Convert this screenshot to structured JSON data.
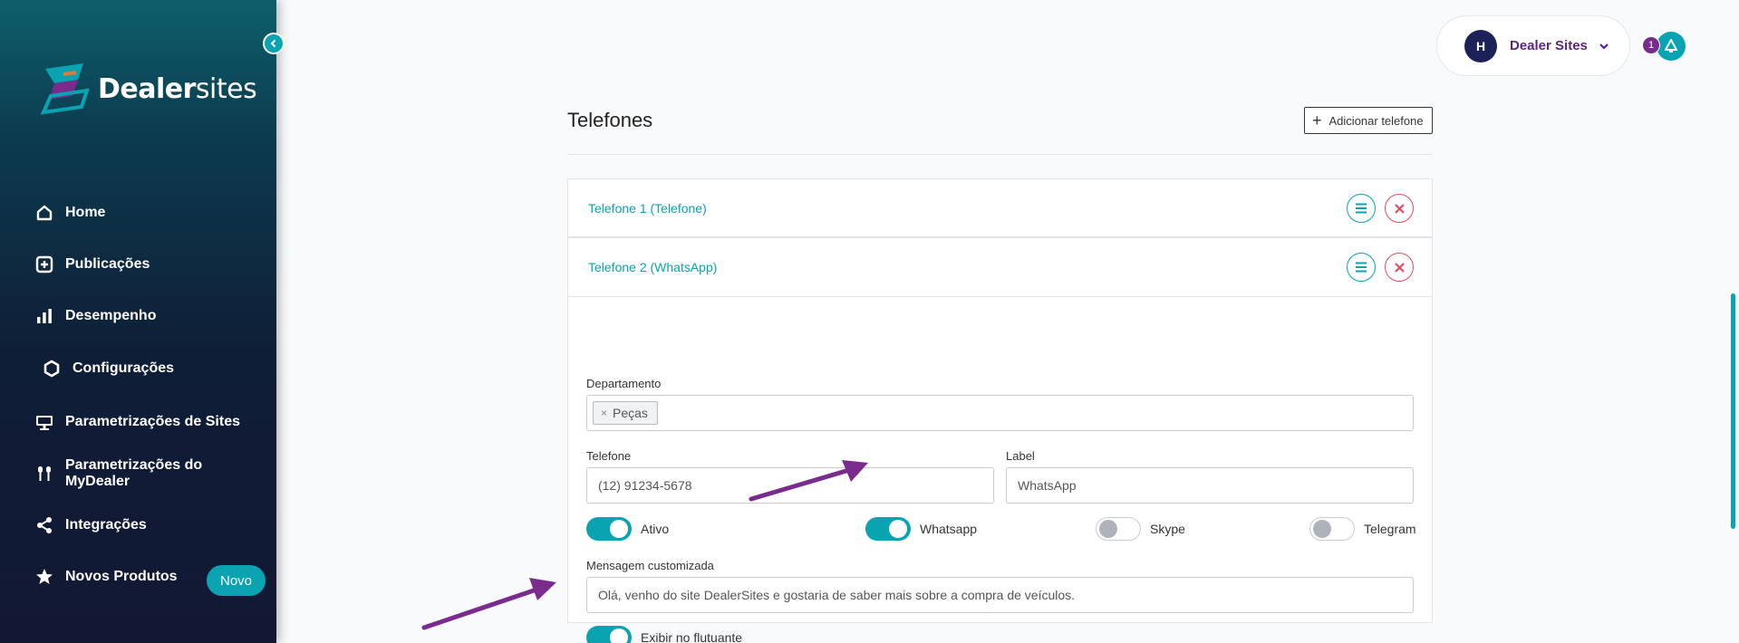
{
  "sidebar": {
    "logo_bold": "Dealer",
    "logo_light": "sites",
    "items": [
      {
        "label": "Home",
        "icon": "home-icon"
      },
      {
        "label": "Publicações",
        "icon": "plus-square-icon"
      },
      {
        "label": "Desempenho",
        "icon": "bar-chart-icon"
      },
      {
        "label": "Configurações",
        "icon": "hexagon-icon"
      },
      {
        "label": "Parametrizações de Sites",
        "icon": "monitor-icon"
      },
      {
        "label": "Parametrizações do MyDealer",
        "icon": "utensils-icon"
      },
      {
        "label": "Integrações",
        "icon": "share-icon"
      },
      {
        "label": "Novos Produtos",
        "icon": "star-icon"
      }
    ],
    "badge": "Novo"
  },
  "header": {
    "avatar_initial": "H",
    "account_name": "Dealer Sites",
    "notification_count": "1"
  },
  "main": {
    "title": "Telefones",
    "add_button": "Adicionar telefone",
    "phones": [
      {
        "title": "Telefone 1 (Telefone)"
      },
      {
        "title": "Telefone 2 (WhatsApp)"
      }
    ],
    "form": {
      "departamento_label": "Departamento",
      "departamento_tag": "Peças",
      "telefone_label": "Telefone",
      "telefone_value": "(12) 91234-5678",
      "label_label": "Label",
      "label_value": "WhatsApp",
      "toggles": [
        {
          "label": "Ativo",
          "on": true
        },
        {
          "label": "Whatsapp",
          "on": true
        },
        {
          "label": "Skype",
          "on": false
        },
        {
          "label": "Telegram",
          "on": false
        }
      ],
      "mensagem_label": "Mensagem customizada",
      "mensagem_value": "Olá, venho do site DealerSites e gostaria de saber mais sobre a compra de veículos.",
      "flutuante_label": "Exibir no flutuante",
      "flutuante_on": true
    }
  },
  "colors": {
    "accent": "#0aa3b1",
    "brand_purple": "#5d2483",
    "danger": "#e34b62",
    "arrow": "#7a2b8e"
  }
}
